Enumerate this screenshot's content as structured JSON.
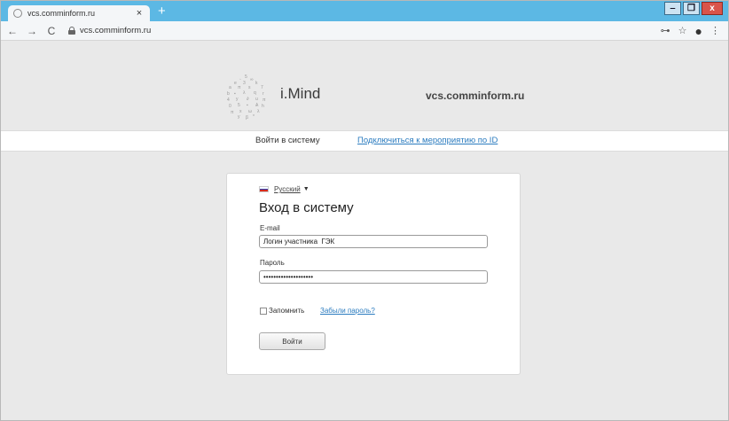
{
  "browser": {
    "tab_title": "vcs.comminform.ru",
    "tab_close": "×",
    "new_tab": "+",
    "url": "vcs.comminform.ru",
    "nav": {
      "back": "←",
      "forward": "→",
      "reload": "C"
    },
    "toolbar_icons": {
      "key": "⊶",
      "star": "☆",
      "account": "●",
      "menu": "⋮"
    },
    "window_buttons": {
      "minimize": "‒",
      "maximize": "❐",
      "close": "x"
    },
    "colors": {
      "tabstrip": "#5cb8e4",
      "toolbar": "#f4f6f8"
    }
  },
  "site": {
    "logo_text": "i.Mind",
    "domain_heading": "vcs.comminform.ru",
    "nav": {
      "login": "Войти в систему",
      "join_event": "Подключиться к мероприятию по ID"
    }
  },
  "login": {
    "language": "Русский",
    "title": "Вход в систему",
    "email_label": "E-mail",
    "email_value": "Логин участника  ГЭК",
    "password_label": "Пароль",
    "password_value": "••••••••••••••••••••",
    "remember_label": "Запомнить",
    "remember_checked": false,
    "forgot_label": "Забыли пароль?",
    "submit_label": "Войти",
    "colors": {
      "link": "#2a7bbf"
    }
  }
}
